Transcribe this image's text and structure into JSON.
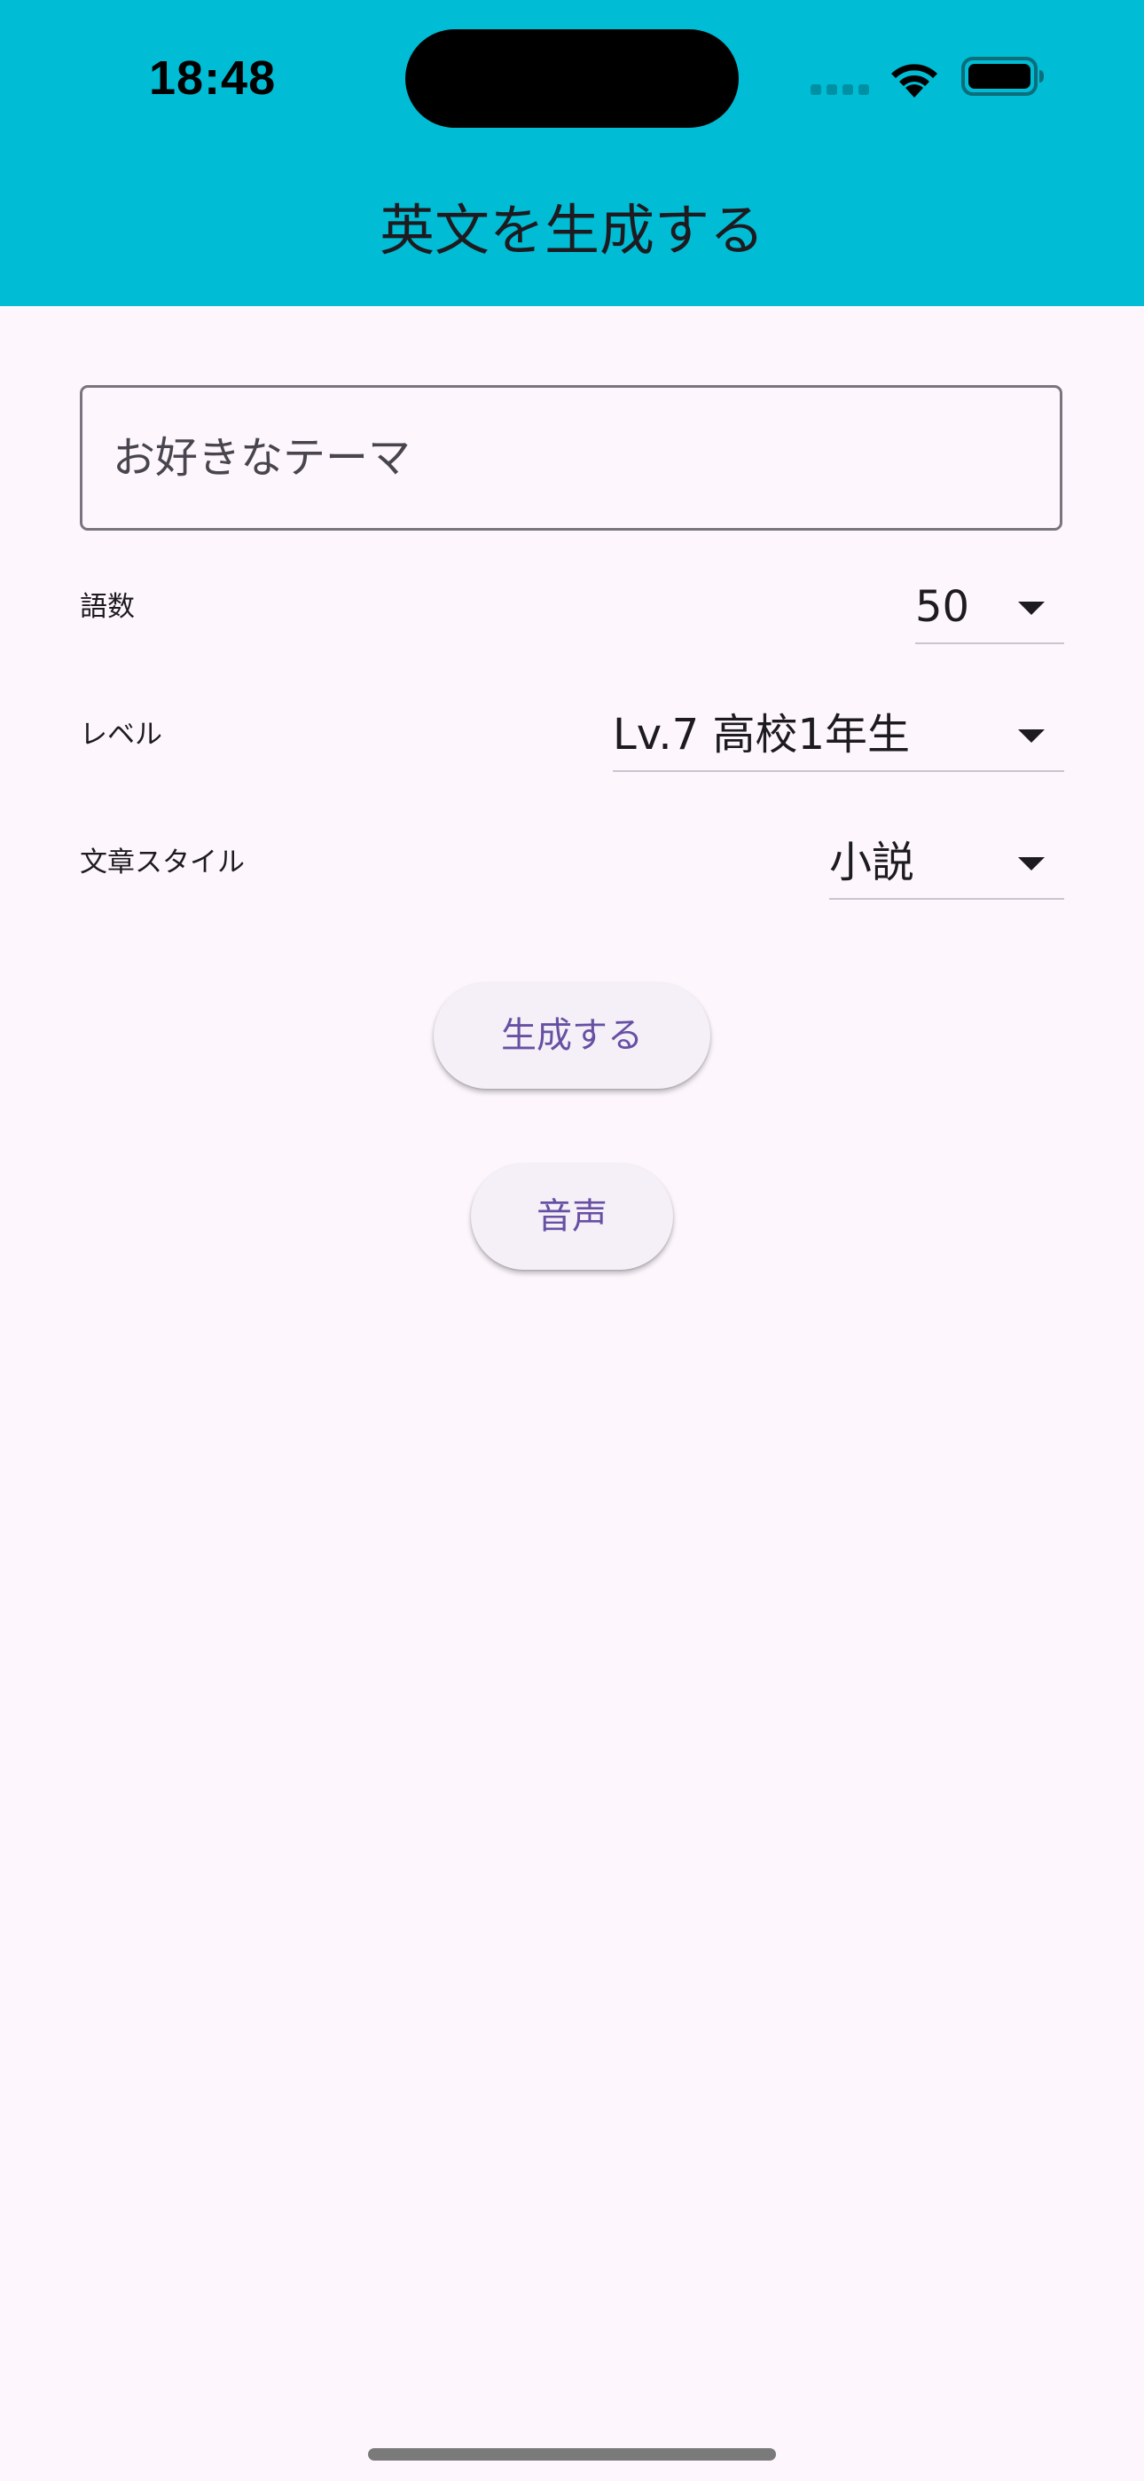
{
  "status_bar": {
    "time": "18:48"
  },
  "app_bar": {
    "title": "英文を生成する",
    "background_color": "#00bcd4"
  },
  "theme_input": {
    "value": "",
    "placeholder": "お好きなテーマ"
  },
  "word_count": {
    "label": "語数",
    "selected": "50"
  },
  "level": {
    "label": "レベル",
    "selected": "Lv.7 高校1年生"
  },
  "style": {
    "label": "文章スタイル",
    "selected": "小説"
  },
  "actions": {
    "generate_label": "生成する",
    "audio_label": "音声"
  },
  "icons": [
    "signal-icon",
    "wifi-icon",
    "battery-icon",
    "chevron-down-icon"
  ],
  "colors": {
    "accent": "#6750a4",
    "page_background": "#fdf7fd",
    "button_background": "#f5f0f7"
  }
}
